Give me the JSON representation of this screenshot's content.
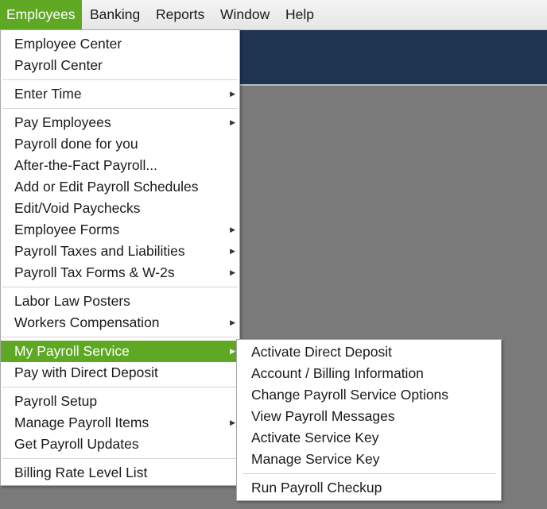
{
  "menubar": {
    "items": [
      {
        "label": "Employees"
      },
      {
        "label": "Banking"
      },
      {
        "label": "Reports"
      },
      {
        "label": "Window"
      },
      {
        "label": "Help"
      }
    ]
  },
  "employees_menu": {
    "items": [
      {
        "label": "Employee Center"
      },
      {
        "label": "Payroll Center"
      },
      {
        "label": "Enter Time"
      },
      {
        "label": "Pay Employees"
      },
      {
        "label": "Payroll done for you"
      },
      {
        "label": "After-the-Fact Payroll..."
      },
      {
        "label": "Add or Edit Payroll Schedules"
      },
      {
        "label": "Edit/Void Paychecks"
      },
      {
        "label": "Employee Forms"
      },
      {
        "label": "Payroll Taxes and Liabilities"
      },
      {
        "label": "Payroll Tax Forms & W-2s"
      },
      {
        "label": "Labor Law Posters"
      },
      {
        "label": "Workers Compensation"
      },
      {
        "label": "My Payroll Service"
      },
      {
        "label": "Pay with Direct Deposit"
      },
      {
        "label": "Payroll Setup"
      },
      {
        "label": "Manage Payroll Items"
      },
      {
        "label": "Get Payroll Updates"
      },
      {
        "label": "Billing Rate Level List"
      }
    ]
  },
  "payroll_service_submenu": {
    "items": [
      {
        "label": "Activate Direct Deposit"
      },
      {
        "label": "Account / Billing Information"
      },
      {
        "label": "Change Payroll Service Options"
      },
      {
        "label": "View Payroll Messages"
      },
      {
        "label": "Activate Service Key"
      },
      {
        "label": "Manage Service Key"
      },
      {
        "label": "Run Payroll Checkup"
      }
    ]
  },
  "colors": {
    "accent_green": "#5ea823",
    "header_navy": "#1f3552",
    "workspace_grey": "#7a7a7a"
  },
  "icons": {
    "submenu_arrow": "right-triangle-icon"
  }
}
